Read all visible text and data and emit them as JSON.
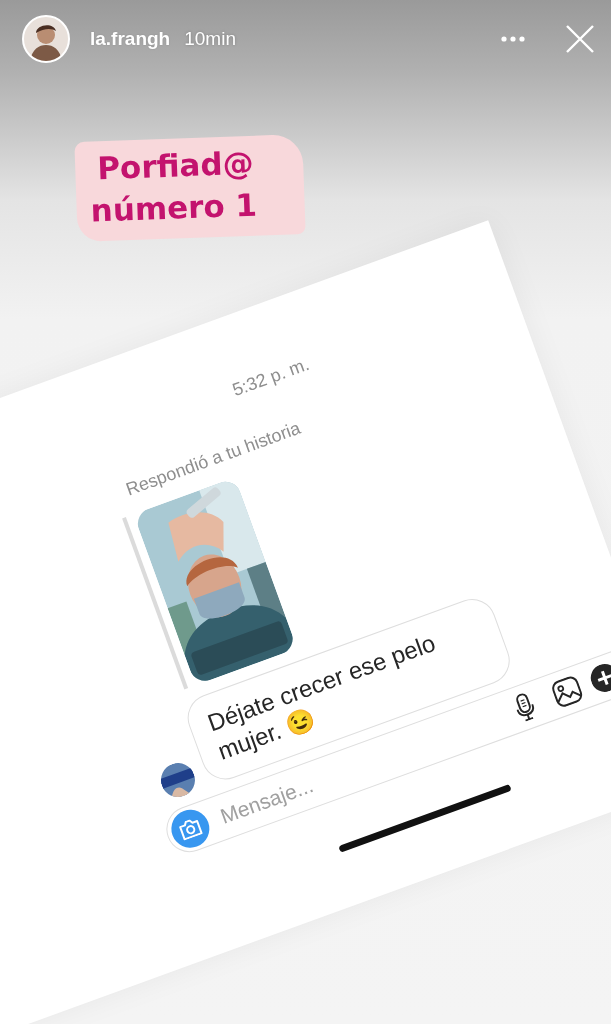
{
  "story_header": {
    "username": "la.frangh",
    "time": "10min"
  },
  "sticker": {
    "lines": [
      "Porfiad@",
      "número 1"
    ]
  },
  "chat": {
    "timestamp": "5:32 p. m.",
    "reply_label": "Respondió a tu historia",
    "message": "Déjate crecer ese pelo mujer. 😉",
    "composer": {
      "placeholder": "Mensaje..."
    }
  }
}
